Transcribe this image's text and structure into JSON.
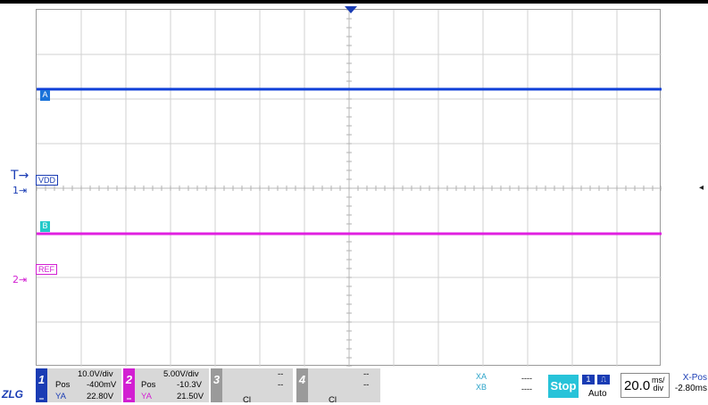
{
  "channels": {
    "ch1": {
      "number": "1",
      "scale": "10.0V/div",
      "pos_label": "Pos",
      "pos_value": "-400mV",
      "ya_label": "YA",
      "ya_value": "22.80V",
      "color": "#1a3cb4"
    },
    "ch2": {
      "number": "2",
      "scale": "5.00V/div",
      "pos_label": "Pos",
      "pos_value": "-10.3V",
      "ya_label": "YA",
      "ya_value": "21.50V",
      "color": "#d21fd2"
    },
    "ch3": {
      "number": "3",
      "line1": "--",
      "line2": "--",
      "partial": "Cl"
    },
    "ch4": {
      "number": "4",
      "line1": "--",
      "line2": "--",
      "partial": "Cl"
    }
  },
  "waveform_labels": {
    "a": "A",
    "b": "B",
    "vdd": "VDD",
    "ref": "REF"
  },
  "side_markers": {
    "trigger": "T",
    "ch1": "1",
    "ch2": "2"
  },
  "cursors": {
    "xa_label": "XA",
    "xb_label": "XB",
    "xa_value": "----",
    "xb_value": "----"
  },
  "run_state": "Stop",
  "trigger": {
    "source": "1",
    "mode": "Auto"
  },
  "timebase": {
    "value": "20.0",
    "unit_top": "ms/",
    "unit_bottom": "div"
  },
  "xpos": {
    "label": "X-Pos",
    "value": "-2.80ms"
  },
  "logo_text": "ZLG",
  "colors": {
    "ch1": "#1a3cb4",
    "ch2": "#d21fd2",
    "marker_b": "#23c9c9",
    "stop": "#27c3d9"
  }
}
